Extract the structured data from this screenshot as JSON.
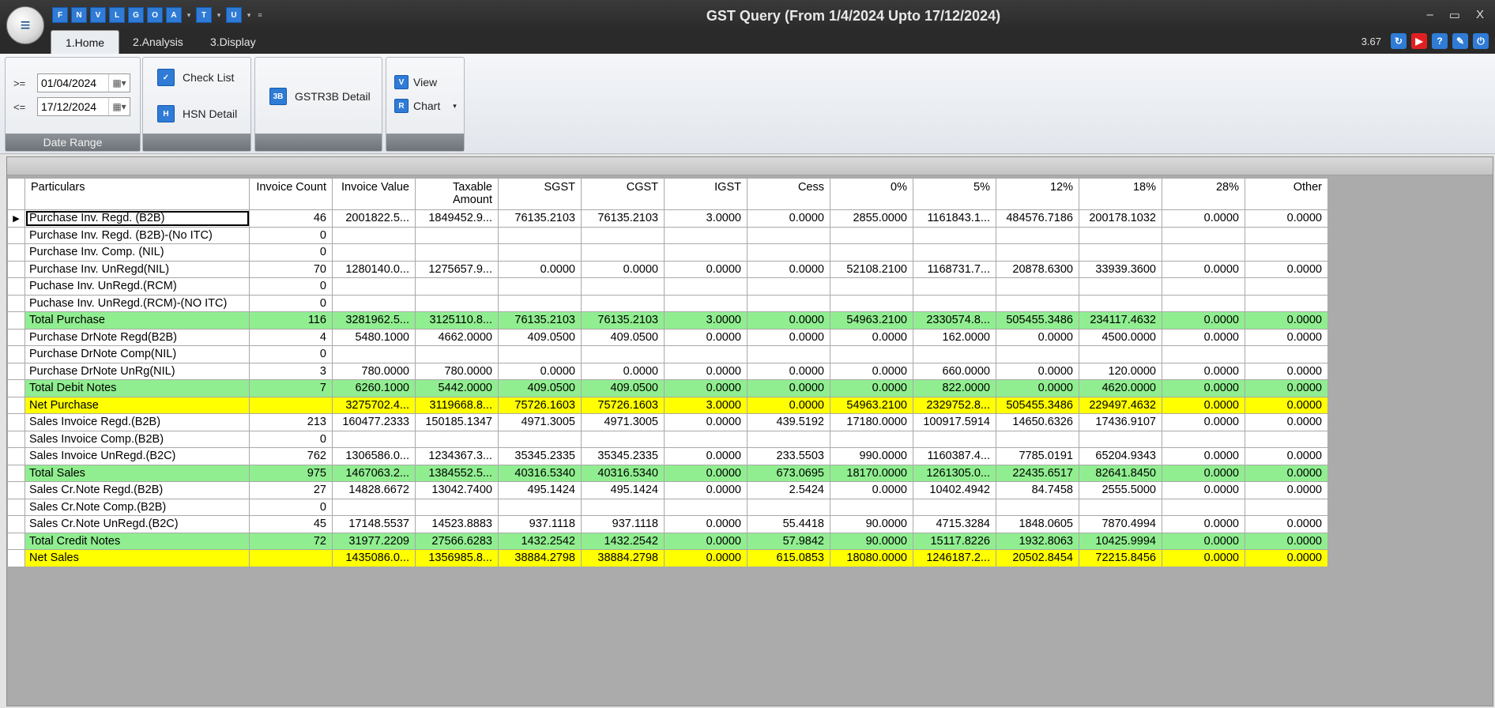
{
  "window": {
    "title": "GST Query (From 1/4/2024 Upto 17/12/2024)",
    "controls": [
      "–",
      "▭",
      "X"
    ]
  },
  "quick_access": [
    "F",
    "N",
    "V",
    "L",
    "G",
    "O",
    "A",
    "T",
    "U"
  ],
  "tabs": [
    {
      "label": "1.Home"
    },
    {
      "label": "2.Analysis"
    },
    {
      "label": "3.Display"
    }
  ],
  "version": "3.67",
  "right_icons": [
    {
      "name": "sync-icon",
      "color": "#2f7bd6"
    },
    {
      "name": "youtube-icon",
      "color": "#e02020"
    },
    {
      "name": "help-icon",
      "color": "#2f7bd6"
    },
    {
      "name": "notes-icon",
      "color": "#2f7bd6"
    },
    {
      "name": "power-icon",
      "color": "#2f7bd6"
    }
  ],
  "ribbon": {
    "date_range": {
      "label": "Date Range",
      "from_op": ">=",
      "from": "01/04/2024",
      "to_op": "<=",
      "to": "17/12/2024"
    },
    "check_list": "Check List",
    "hsn_detail": "HSN Detail",
    "gstr3b_detail": "GSTR3B Detail",
    "view": "View",
    "chart": "Chart"
  },
  "grid": {
    "columns": [
      "Particulars",
      "Invoice Count",
      "Invoice Value",
      "Taxable Amount",
      "SGST",
      "CGST",
      "IGST",
      "Cess",
      "0%",
      "5%",
      "12%",
      "18%",
      "28%",
      "Other"
    ],
    "rows": [
      {
        "style": "normal",
        "cells": [
          "Purchase Inv. Regd. (B2B)",
          "46",
          "2001822.5...",
          "1849452.9...",
          "76135.2103",
          "76135.2103",
          "3.0000",
          "0.0000",
          "2855.0000",
          "1161843.1...",
          "484576.7186",
          "200178.1032",
          "0.0000",
          "0.0000"
        ]
      },
      {
        "style": "normal",
        "cells": [
          "Purchase Inv. Regd. (B2B)-(No ITC)",
          "0",
          "",
          "",
          "",
          "",
          "",
          "",
          "",
          "",
          "",
          "",
          "",
          ""
        ]
      },
      {
        "style": "normal",
        "cells": [
          "Purchase Inv. Comp. (NIL)",
          "0",
          "",
          "",
          "",
          "",
          "",
          "",
          "",
          "",
          "",
          "",
          "",
          ""
        ]
      },
      {
        "style": "normal",
        "cells": [
          "Purchase Inv. UnRegd(NIL)",
          "70",
          "1280140.0...",
          "1275657.9...",
          "0.0000",
          "0.0000",
          "0.0000",
          "0.0000",
          "52108.2100",
          "1168731.7...",
          "20878.6300",
          "33939.3600",
          "0.0000",
          "0.0000"
        ]
      },
      {
        "style": "normal",
        "cells": [
          "Puchase Inv. UnRegd.(RCM)",
          "0",
          "",
          "",
          "",
          "",
          "",
          "",
          "",
          "",
          "",
          "",
          "",
          ""
        ]
      },
      {
        "style": "normal",
        "cells": [
          "Puchase Inv. UnRegd.(RCM)-(NO ITC)",
          "0",
          "",
          "",
          "",
          "",
          "",
          "",
          "",
          "",
          "",
          "",
          "",
          ""
        ]
      },
      {
        "style": "green",
        "cells": [
          "Total Purchase",
          "116",
          "3281962.5...",
          "3125110.8...",
          "76135.2103",
          "76135.2103",
          "3.0000",
          "0.0000",
          "54963.2100",
          "2330574.8...",
          "505455.3486",
          "234117.4632",
          "0.0000",
          "0.0000"
        ]
      },
      {
        "style": "normal",
        "cells": [
          "Purchase DrNote Regd(B2B)",
          "4",
          "5480.1000",
          "4662.0000",
          "409.0500",
          "409.0500",
          "0.0000",
          "0.0000",
          "0.0000",
          "162.0000",
          "0.0000",
          "4500.0000",
          "0.0000",
          "0.0000"
        ]
      },
      {
        "style": "normal",
        "cells": [
          "Purchase DrNote Comp(NIL)",
          "0",
          "",
          "",
          "",
          "",
          "",
          "",
          "",
          "",
          "",
          "",
          "",
          ""
        ]
      },
      {
        "style": "normal",
        "cells": [
          "Purchase DrNote UnRg(NIL)",
          "3",
          "780.0000",
          "780.0000",
          "0.0000",
          "0.0000",
          "0.0000",
          "0.0000",
          "0.0000",
          "660.0000",
          "0.0000",
          "120.0000",
          "0.0000",
          "0.0000"
        ]
      },
      {
        "style": "green",
        "cells": [
          "Total Debit Notes",
          "7",
          "6260.1000",
          "5442.0000",
          "409.0500",
          "409.0500",
          "0.0000",
          "0.0000",
          "0.0000",
          "822.0000",
          "0.0000",
          "4620.0000",
          "0.0000",
          "0.0000"
        ]
      },
      {
        "style": "yellow",
        "cells": [
          "Net Purchase",
          "",
          "3275702.4...",
          "3119668.8...",
          "75726.1603",
          "75726.1603",
          "3.0000",
          "0.0000",
          "54963.2100",
          "2329752.8...",
          "505455.3486",
          "229497.4632",
          "0.0000",
          "0.0000"
        ]
      },
      {
        "style": "normal",
        "cells": [
          "Sales Invoice Regd.(B2B)",
          "213",
          "160477.2333",
          "150185.1347",
          "4971.3005",
          "4971.3005",
          "0.0000",
          "439.5192",
          "17180.0000",
          "100917.5914",
          "14650.6326",
          "17436.9107",
          "0.0000",
          "0.0000"
        ]
      },
      {
        "style": "normal",
        "cells": [
          "Sales Invoice Comp.(B2B)",
          "0",
          "",
          "",
          "",
          "",
          "",
          "",
          "",
          "",
          "",
          "",
          "",
          ""
        ]
      },
      {
        "style": "normal",
        "cells": [
          "Sales Invoice UnRegd.(B2C)",
          "762",
          "1306586.0...",
          "1234367.3...",
          "35345.2335",
          "35345.2335",
          "0.0000",
          "233.5503",
          "990.0000",
          "1160387.4...",
          "7785.0191",
          "65204.9343",
          "0.0000",
          "0.0000"
        ]
      },
      {
        "style": "green",
        "cells": [
          "Total Sales",
          "975",
          "1467063.2...",
          "1384552.5...",
          "40316.5340",
          "40316.5340",
          "0.0000",
          "673.0695",
          "18170.0000",
          "1261305.0...",
          "22435.6517",
          "82641.8450",
          "0.0000",
          "0.0000"
        ]
      },
      {
        "style": "normal",
        "cells": [
          "Sales Cr.Note Regd.(B2B)",
          "27",
          "14828.6672",
          "13042.7400",
          "495.1424",
          "495.1424",
          "0.0000",
          "2.5424",
          "0.0000",
          "10402.4942",
          "84.7458",
          "2555.5000",
          "0.0000",
          "0.0000"
        ]
      },
      {
        "style": "normal",
        "cells": [
          "Sales Cr.Note Comp.(B2B)",
          "0",
          "",
          "",
          "",
          "",
          "",
          "",
          "",
          "",
          "",
          "",
          "",
          ""
        ]
      },
      {
        "style": "normal",
        "cells": [
          "Sales Cr.Note UnRegd.(B2C)",
          "45",
          "17148.5537",
          "14523.8883",
          "937.1118",
          "937.1118",
          "0.0000",
          "55.4418",
          "90.0000",
          "4715.3284",
          "1848.0605",
          "7870.4994",
          "0.0000",
          "0.0000"
        ]
      },
      {
        "style": "green",
        "cells": [
          "Total Credit Notes",
          "72",
          "31977.2209",
          "27566.6283",
          "1432.2542",
          "1432.2542",
          "0.0000",
          "57.9842",
          "90.0000",
          "15117.8226",
          "1932.8063",
          "10425.9994",
          "0.0000",
          "0.0000"
        ]
      },
      {
        "style": "yellow",
        "cells": [
          "Net Sales",
          "",
          "1435086.0...",
          "1356985.8...",
          "38884.2798",
          "38884.2798",
          "0.0000",
          "615.0853",
          "18080.0000",
          "1246187.2...",
          "20502.8454",
          "72215.8456",
          "0.0000",
          "0.0000"
        ]
      }
    ]
  }
}
